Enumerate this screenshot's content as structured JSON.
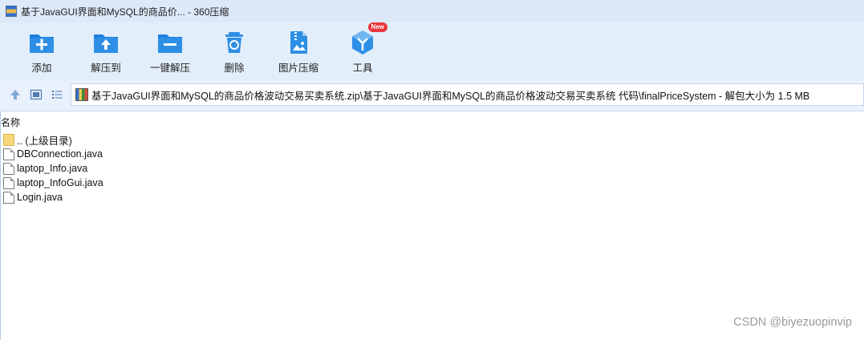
{
  "window": {
    "title": "基于JavaGUI界面和MySQL的商品价... - 360压缩",
    "icon": "archive-app-icon"
  },
  "toolbar": {
    "items": [
      {
        "label": "添加",
        "icon": "add-icon"
      },
      {
        "label": "解压到",
        "icon": "extract-to-icon"
      },
      {
        "label": "一键解压",
        "icon": "one-click-extract-icon"
      },
      {
        "label": "删除",
        "icon": "recycle-delete-icon"
      },
      {
        "label": "图片压缩",
        "icon": "image-compress-icon"
      },
      {
        "label": "工具",
        "icon": "tools-cube-icon",
        "badge": "New"
      }
    ]
  },
  "address": {
    "path": "基于JavaGUI界面和MySQL的商品价格波动交易买卖系统.zip\\基于JavaGUI界面和MySQL的商品价格波动交易买卖系统 代码\\finalPriceSystem - 解包大小为 1.5 MB",
    "nav_icons": [
      "up-arrow-icon",
      "view-thumbnail-icon",
      "view-list-icon"
    ]
  },
  "file_list": {
    "column_header": "名称",
    "rows": [
      {
        "name": ".. (上级目录)",
        "type": "folder"
      },
      {
        "name": "DBConnection.java",
        "type": "file"
      },
      {
        "name": "laptop_Info.java",
        "type": "file"
      },
      {
        "name": "laptop_InfoGui.java",
        "type": "file"
      },
      {
        "name": "Login.java",
        "type": "file"
      }
    ]
  },
  "watermark": "CSDN @biyezuopinvip",
  "colors": {
    "accent_blue": "#2f8fe6",
    "toolbar_bg": "#e3eefb",
    "badge_red": "#e8343a"
  }
}
